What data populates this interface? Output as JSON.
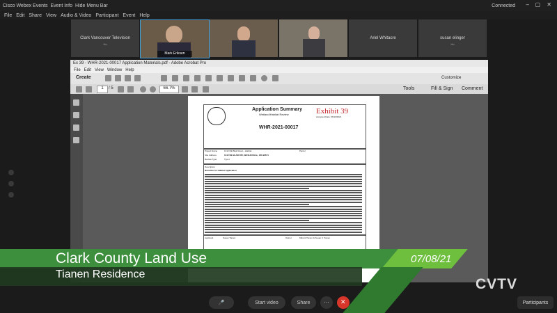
{
  "app": {
    "title": "Cisco Webex Events",
    "event_info": "Event Info",
    "hide_menu": "Hide Menu Bar",
    "status": "Connected"
  },
  "menu": [
    "File",
    "Edit",
    "Share",
    "View",
    "Audio & Video",
    "Participant",
    "Event",
    "Help"
  ],
  "participants": [
    {
      "name": "Clark Vancouver Television",
      "sub": "Ho"
    },
    {
      "name": "Mark Eriksen"
    },
    {
      "name": "Ariel Whitacre"
    },
    {
      "name": "susan elinger",
      "sub": "Ho"
    }
  ],
  "acrobat": {
    "title": "Ex 39 - WHR-2021-00017 Application Materials.pdf - Adobe Acrobat Pro",
    "menu": [
      "File",
      "Edit",
      "View",
      "Window",
      "Help"
    ],
    "create": "Create",
    "customize": "Customize",
    "page": "1",
    "page_total": "/ 5",
    "zoom": "66.7%",
    "right_tabs": [
      "Tools",
      "Fill & Sign",
      "Comment"
    ]
  },
  "pdf": {
    "heading": "Application Summary",
    "subheading": "Wetland/Habitat Review",
    "exhibit": "Exhibit 39",
    "accepted": "Accepted Date: 06/10/2021",
    "case": "WHR-2021-00017",
    "project_name_label": "Project Name",
    "project_name": "1312 NE Blair Road – Habitat",
    "parcel_label": "Parcel",
    "site_address_label": "Site Address",
    "site_address": "1312 NE BLAIR RD, WASHOUGAL, WA 98671",
    "review_type_label": "Review Type",
    "review_type": "Type I",
    "description_label": "Description",
    "description_title": "Narrative for Habitat Application",
    "applicant_label": "Applicant",
    "applicant": "Susan Tianen",
    "owner_label": "Owner",
    "owner": "Mika & Tianen & Susan C Tianen"
  },
  "lower_third": {
    "title": "Clark County Land Use",
    "subtitle": "Tianen Residence",
    "date": "07/08/21"
  },
  "logo": "CVTV",
  "controls": {
    "start_video": "Start video",
    "share": "Share",
    "participants": "Participants"
  }
}
